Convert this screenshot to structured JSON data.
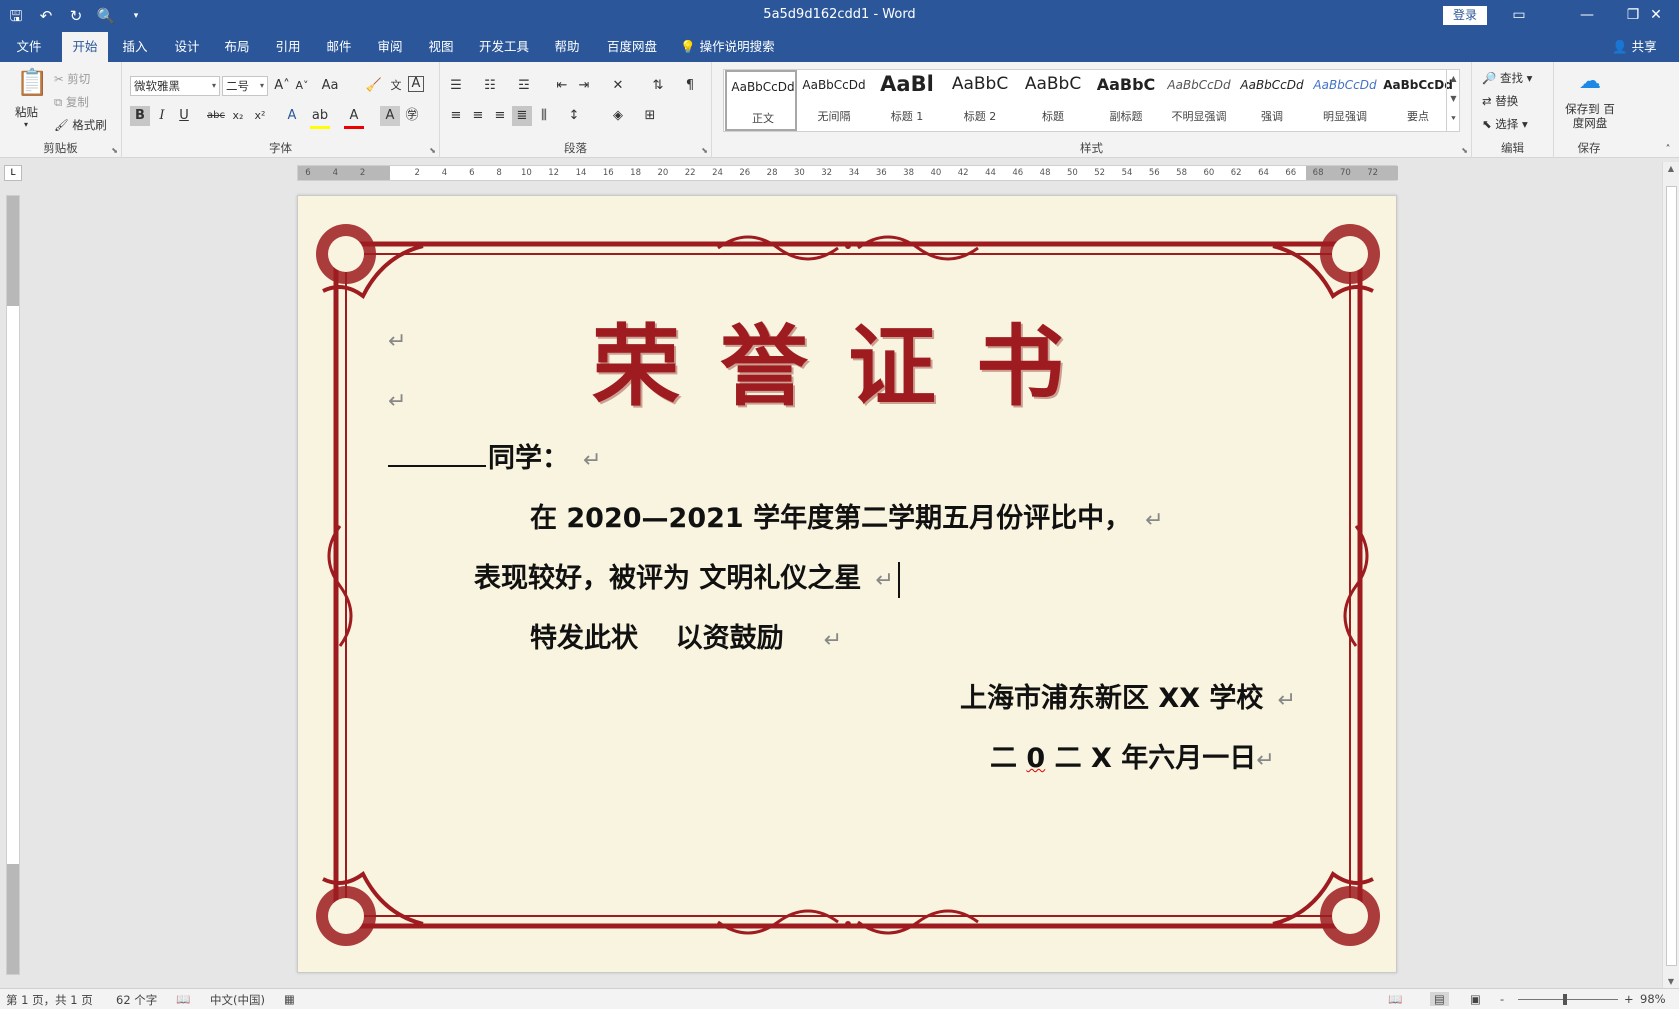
{
  "window": {
    "title": "5a5d9d162cdd1  -  Word",
    "login_label": "登录"
  },
  "tabs": [
    "文件",
    "开始",
    "插入",
    "设计",
    "布局",
    "引用",
    "邮件",
    "审阅",
    "视图",
    "开发工具",
    "帮助",
    "百度网盘"
  ],
  "active_tab": "开始",
  "tell_me": "操作说明搜索",
  "share_label": "共享",
  "ribbon": {
    "clipboard": {
      "paste": "粘贴",
      "cut": "剪切",
      "copy": "复制",
      "format_painter": "格式刷",
      "label": "剪贴板"
    },
    "font": {
      "font_name": "微软雅黑",
      "font_size": "二号",
      "label": "字体"
    },
    "paragraph": {
      "label": "段落"
    },
    "styles": {
      "label": "样式",
      "items": [
        {
          "sample": "AaBbCcDd",
          "name": "正文"
        },
        {
          "sample": "AaBbCcDd",
          "name": "无间隔"
        },
        {
          "sample": "AaBl",
          "name": "标题 1"
        },
        {
          "sample": "AaBbC",
          "name": "标题 2"
        },
        {
          "sample": "AaBbC",
          "name": "标题"
        },
        {
          "sample": "AaBbC",
          "name": "副标题"
        },
        {
          "sample": "AaBbCcDd",
          "name": "不明显强调"
        },
        {
          "sample": "AaBbCcDd",
          "name": "强调"
        },
        {
          "sample": "AaBbCcDd",
          "name": "明显强调"
        },
        {
          "sample": "AaBbCcDd",
          "name": "要点"
        }
      ]
    },
    "editing": {
      "find": "查找",
      "replace": "替换",
      "select": "选择",
      "label": "编辑"
    },
    "save": {
      "button": "保存到 百度网盘",
      "label": "保存"
    }
  },
  "ruler": {
    "ticks": [
      "6",
      "4",
      "2",
      "",
      "2",
      "4",
      "6",
      "8",
      "10",
      "12",
      "14",
      "16",
      "18",
      "20",
      "22",
      "24",
      "26",
      "28",
      "30",
      "32",
      "34",
      "36",
      "38",
      "40",
      "42",
      "44",
      "46",
      "48",
      "50",
      "52",
      "54",
      "56",
      "58",
      "60",
      "62",
      "64",
      "66",
      "68",
      "70",
      "72"
    ]
  },
  "document": {
    "title": "荣誉证书",
    "salutation": "同学：",
    "line1": "在 2020—2021 学年度第二学期五月份评比中，",
    "line2": "表现较好，被评为  文明礼仪之星",
    "line3": "特发此状    以资鼓励",
    "issuer": "上海市浦东新区 XX 学校",
    "date_pre": "二",
    "date_zero": "0",
    "date_post": " 二 X 年六月一日",
    "para_mark": "↵",
    "colors": {
      "border": "#9e1b20",
      "background": "#f8f4df",
      "title": "#9e1b20"
    }
  },
  "status": {
    "page": "第 1 页，共 1 页",
    "words": "62 个字",
    "language": "中文(中国)",
    "zoom": "98%",
    "zoom_minus": "-",
    "zoom_plus": "+"
  }
}
